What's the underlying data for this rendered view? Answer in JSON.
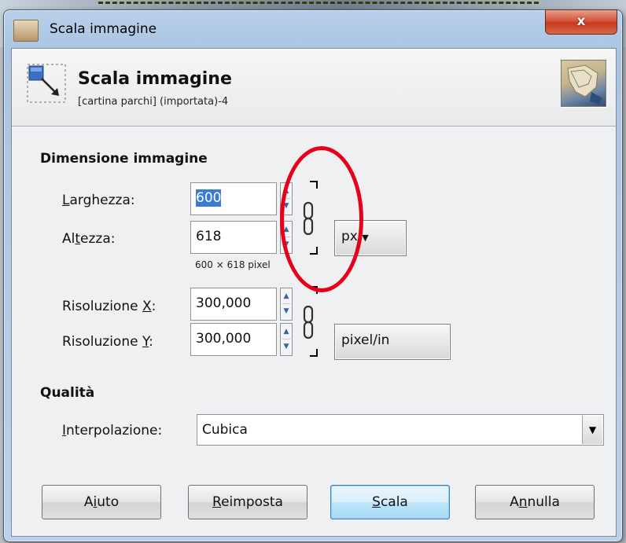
{
  "window": {
    "title": "Scala immagine",
    "close_label": "x"
  },
  "header": {
    "title": "Scala immagine",
    "subtitle": "[cartina parchi] (importata)-4"
  },
  "size_section": {
    "title": "Dimensione immagine",
    "width_label_prefix": "",
    "width_label_mnemonic": "L",
    "width_label_rest": "arghezza:",
    "width_value": "600",
    "height_label_prefix": "Al",
    "height_label_mnemonic": "t",
    "height_label_rest": "ezza:",
    "height_value": "618",
    "pixel_size_text": "600 × 618 pixel",
    "unit_value": "px",
    "res_x_label_prefix": "Risoluzione ",
    "res_x_label_mnemonic": "X",
    "res_x_label_rest": ":",
    "res_x_value": "300,000",
    "res_y_label_prefix": "Risoluzione ",
    "res_y_label_mnemonic": "Y",
    "res_y_label_rest": ":",
    "res_y_value": "300,000",
    "res_unit_value": "pixel/in"
  },
  "quality_section": {
    "title": "Qualità",
    "interp_label_mnemonic": "I",
    "interp_label_rest": "nterpolazione:",
    "interp_value": "Cubica"
  },
  "buttons": {
    "help_prefix": "A",
    "help_mnemonic": "i",
    "help_rest": "uto",
    "reset_mnemonic": "R",
    "reset_rest": "eimposta",
    "scale_mnemonic": "S",
    "scale_rest": "cala",
    "cancel_prefix": "A",
    "cancel_mnemonic": "n",
    "cancel_rest": "nulla"
  },
  "icons": [
    "app-icon",
    "close-icon",
    "scale-image-icon",
    "chain-link-icon",
    "spin-up-icon",
    "spin-down-icon",
    "dropdown-arrow-icon"
  ],
  "colors": {
    "selection": "#3a7bd5",
    "annotation_ellipse": "#e8001a",
    "close_button": "#c7391d"
  }
}
